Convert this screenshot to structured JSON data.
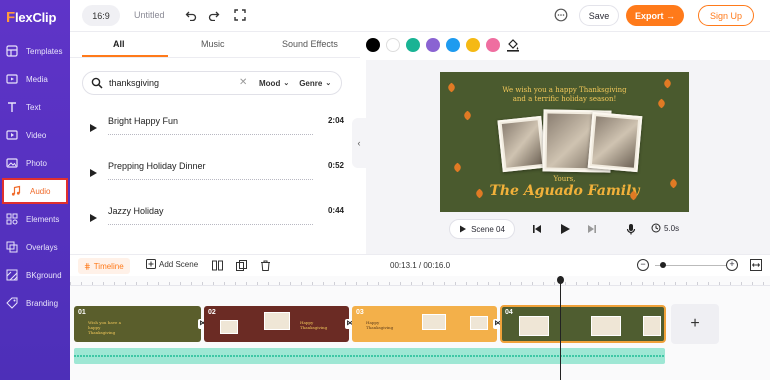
{
  "app": {
    "logo_text": "lexClip",
    "logo_f": "F"
  },
  "sidebar": {
    "items": [
      {
        "label": "Templates",
        "icon": "templates-icon"
      },
      {
        "label": "Media",
        "icon": "media-icon"
      },
      {
        "label": "Text",
        "icon": "text-icon"
      },
      {
        "label": "Video",
        "icon": "video-icon"
      },
      {
        "label": "Photo",
        "icon": "photo-icon"
      },
      {
        "label": "Audio",
        "icon": "audio-icon",
        "active": true
      },
      {
        "label": "Elements",
        "icon": "elements-icon"
      },
      {
        "label": "Overlays",
        "icon": "overlays-icon"
      },
      {
        "label": "BKground",
        "icon": "background-icon"
      },
      {
        "label": "Branding",
        "icon": "branding-icon"
      }
    ]
  },
  "topbar": {
    "ratio": "16:9",
    "project_title": "Untitled",
    "save_label": "Save",
    "export_label": "Export →",
    "signup_label": "Sign Up"
  },
  "library": {
    "tabs": [
      {
        "label": "All",
        "active": true
      },
      {
        "label": "Music"
      },
      {
        "label": "Sound Effects"
      }
    ],
    "search": {
      "value": "thanksgiving",
      "mood_label": "Mood",
      "genre_label": "Genre"
    },
    "tracks": [
      {
        "name": "Bright Happy Fun",
        "duration": "2:04"
      },
      {
        "name": "Prepping Holiday Dinner",
        "duration": "0:52"
      },
      {
        "name": "Jazzy Holiday",
        "duration": "0:44"
      }
    ]
  },
  "colors": {
    "swatches": [
      "#000000",
      "#ffffff",
      "#19b394",
      "#8a63d2",
      "#1e9bef",
      "#f5b914",
      "#ef6ea0"
    ],
    "accent": "#ff7a1a",
    "sidebar": "#5a33c4"
  },
  "preview": {
    "caption_line1": "We wish you a happy Thanksgiving",
    "caption_line2": "and a terrific holiday season!",
    "yours": "Yours,",
    "family": "The Aguado Family",
    "scene_label": "Scene 04",
    "duration": "5.0s"
  },
  "timeline": {
    "timeline_label": "Timeline",
    "add_scene_label": "Add Scene",
    "timecode": "00:13.1 / 00:16.0",
    "clips": [
      {
        "num": "01",
        "text": "Wish you have a happy Thanksgiving",
        "color": "#5a5e2c"
      },
      {
        "num": "02",
        "text": "Happy Thanksgiving",
        "color": "#6b2b24"
      },
      {
        "num": "03",
        "text": "Happy Thanksgiving",
        "color": "#f3b04a"
      },
      {
        "num": "04",
        "text": "",
        "color": "#4f5d30",
        "selected": true
      }
    ],
    "add_clip_label": "+"
  }
}
